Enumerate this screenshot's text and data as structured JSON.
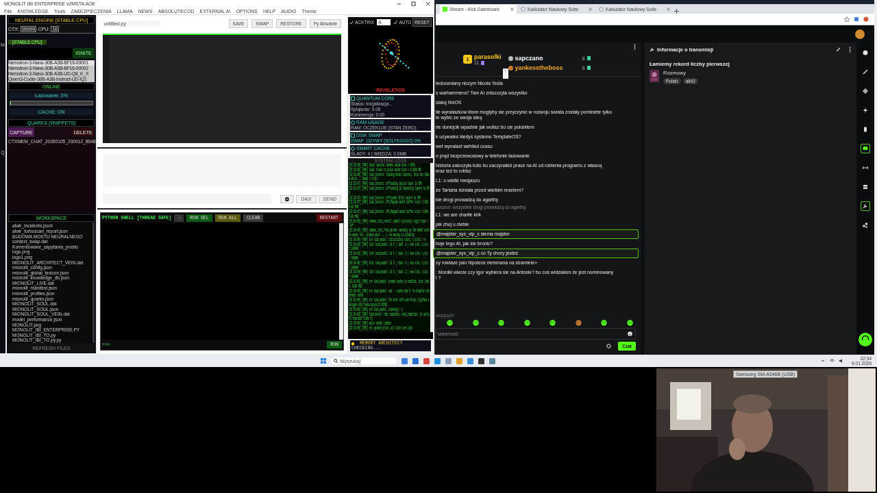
{
  "app": {
    "title": "MONOLIT IBI ENTERPRISE v2MSTA AOE",
    "side_letters": [
      "M",
      "Q"
    ],
    "menu": [
      "File",
      "KNOWLEDGE",
      "Tools",
      "ZABEZPIECZENIA",
      "LLAMA",
      "NEWS",
      "ABSOLUTECOD",
      "EXTERNAL AI",
      "OPTIONS",
      "HELP",
      "AUDIO",
      "Theme"
    ],
    "engine": {
      "title": "NEURAL ENGINE [STABLE-CPU]",
      "ctx_label": "CTX:",
      "ctx": "99999",
      "cpu_label": "CPU:",
      "cpu": "16",
      "badge": "[STABLE CPU]",
      "ignite": "IGNITE",
      "models": [
        {
          "name": "Nemotron-3-Nano-30B-A3B-BF16-00001",
          "selected": true
        },
        {
          "name": "Nemotron-3-Nano-30B-A3B-BF16-00002",
          "selected": false
        },
        {
          "name": "Nemotron-3-Nano-30B-A3B-UD-Q8_K_X",
          "selected": false
        },
        {
          "name": "Qwen3-Coder-30B-A3B-Instruct-UD-IQ1",
          "selected": false
        }
      ],
      "status": "ONLINE",
      "loading": "Ładowanie: 0%",
      "level": 0,
      "cache": "CACHE: ON"
    },
    "quarks": {
      "title": "QUARKS (SNIPPETS)",
      "capture": "CAPTURE",
      "delete": "DELETE",
      "items": [
        "CTXMEM_CHAT_20260105_230012_8648"
      ]
    },
    "workspace": {
      "title": "WORKSPACE",
      "files": [
        "alwir_incidents.jsonl",
        "alwir_turboscan_report.json",
        "BUDOWA MOSTU NEURALNEGO",
        "context_swap.dat",
        "Komentowane_zapytania_prosto",
        "logo.png",
        "logo1.png",
        "MIONOLIT_ARCHITECT_VEIN.dat",
        "mionolit_config.json",
        "mionolit_global_lexicon.json",
        "mionolit_knowledge_db.json",
        "MIONOLIT_LIVE.dat",
        "mionolit_manifest.json",
        "mionolit_profiles.json",
        "mionolit_quarks.json",
        "MIONOLIT_SOUL.dat",
        "MIONOLIT_SOUL.json",
        "MIONOLIT_SOUL_VEIN.dat",
        "model_performance.json",
        "MONOLIT.png",
        "MONOLIT_IBI_ENTERPRISE.PY",
        "MONOLIT_IBI_TO.py",
        "MONOLIT_IBI_TO.py.py"
      ],
      "refresh": "REFRESH FILES"
    },
    "editor": {
      "filename": "untitled.py",
      "buttons": [
        "SAVE",
        "SWAP",
        "RESTORE",
        "Py Absolute"
      ]
    },
    "prompt": {
      "daj": "DAJ!",
      "send": "SEND"
    },
    "shell": {
      "title": "PYTHON SHELL [THREAD SAFE]",
      "buttons": [
        {
          "label": "-",
          "kind": "dark"
        },
        {
          "label": "RUN SEL",
          "kind": "green"
        },
        {
          "label": "RUN ALL",
          "kind": "olive"
        },
        {
          "label": "CLEAR",
          "kind": "gray"
        }
      ],
      "restart": "RESTART",
      "prompt": ">>>",
      "run": "RUN"
    },
    "visual": {
      "acktrix": {
        "label": "ACKTRIX",
        "checked": true
      },
      "mode": "A",
      "auto": {
        "label": "AUTO",
        "checked": true
      },
      "reset": "RESET",
      "caption": "REVELATION"
    },
    "cards": [
      {
        "kind": "quantum",
        "title": "QUANTUM CORE",
        "lines": [
          "Status: Inicjalizacja...",
          "Splątanie: 0.00",
          "Koherencja: 0.00"
        ]
      },
      {
        "kind": "ram",
        "title": "RAM USAGE",
        "lines": [
          "RAM: OCZEKUJE (STAN ZERO)"
        ]
      },
      {
        "kind": "disk",
        "title": "DISK SWAP",
        "lines": [
          "SWAP: OŻYWY (SOLFEGGIO) 0%"
        ]
      },
      {
        "kind": "cache",
        "title": "SMART CACHE",
        "lines": [
          "ŚLADY: 4 | WIEDZA: 0.0MB"
        ]
      }
    ],
    "logs": {
      "title": "SYSTEM LOGS",
      "lines": [
        "[22:33:40] [SRV] load: special tokens cache size = 3000",
        "[22:33:40] [SRV] load: token to piece cache size = 0.9420 MB",
        "[22:33:40] [SRV] load_tensors: loading model tensors, this can take a while... (mmap = true)",
        "[22:33:47] [SRV] load_tensors: offloading output layer to GPU",
        "[22:33:47] [SRV] load_tensors: offloading 53 repeating layers to GPU",
        "[22:33:47] [SRV] load_tensors: offloaded 53/53 layers to GPU",
        "[22:33:47] [SRV] load_tensors: CPU_Mapped model buffer size = 17690.96 MiB",
        "[22:33:47] [SRV] load_tensors: CPU_Mapped model buffer size = 12040.90 MiB",
        "[22:34:00] [SRV] common_init_result: added <|im_end|> logit bias = -inf",
        "[22:34:00] [SRV] common_init_from_params: warming up the model with an empty run - please wait ... (--no-warmup to disable)",
        "[22:34:00] [SRV] srv load_model: initializing slots, n_slots = 4",
        "[22:34:00] [SRV] slot load_model: id 0 | task -1 | new slot, n_ctx = 100000",
        "[22:34:00] [SRV] slot load_model: id 1 | task -1 | new slot, n_ctx = 100000",
        "[22:34:00] [SRV] slot load_model: id 2 | task -1 | new slot, n_ctx = 100000",
        "[22:34:00] [SRV] slot load_model: id 3 | task -1 | new slot, n_ctx = 100000",
        "[22:34:00] [SRV] srv load_model: prompt cache is enabled, size limit: 8192 MiB",
        "[22:34:00] [SRV] srv load_model: use `--cache-ram 0` to disable the prompt cache",
        "[22:34:00] [SRV] srv load_model: for more info see https://github.com/ggml-org/llama.cpp/pull/16391",
        "[22:34:00] [SRV] srv load_model: thinking = 1",
        "[22:34:00] [SRV] load_model: chat template, chat_template: (# unsloth template fixes #)",
        "[22:34:00] [SRV] main: model loaded",
        "[22:34:00] [SRV] srv update_slots: all slots are idle"
      ]
    },
    "memory": {
      "title": "MEMORY ARCHITECT",
      "status": "CHECKING..."
    }
  },
  "browser": {
    "tabs": [
      {
        "title": "Stream - Kick Dashboard",
        "selected": true
      },
      {
        "title": "Kalkulator Naukowy Suite",
        "selected": false
      },
      {
        "title": "Kalkulator Naukowy Suite",
        "selected": false
      }
    ],
    "leaders": [
      {
        "rank": "1",
        "name": "parasolki",
        "count": "11",
        "color": "#f5c518"
      },
      {
        "name": "sapczano",
        "count": "8",
        "color": "#ffffff"
      },
      {
        "name": "yankesstheboss",
        "count": "6",
        "color": "#f5a623"
      }
    ],
    "messages": [
      {
        "kind": "plain",
        "lines": [
          "ledoceniany niczym Nicola Tesla"
        ]
      },
      {
        "kind": "plain",
        "lines": [
          "s warhammera? Tam AI zniszczyla wszystko"
        ]
      },
      {
        "kind": "plain",
        "lines": [
          "staluj NixOS"
        ]
      },
      {
        "kind": "plain",
        "lines": [
          "ile wynalazkow ktore moglyby sie przyczynic w rozwoju swiata zostaly pominiete tylko",
          "le wybic ze swoja ideą"
        ]
      },
      {
        "kind": "plain",
        "lines": [
          "rie donejcik wpadnie jak wolisz bo cie polubilem"
        ]
      },
      {
        "kind": "plain",
        "lines": [
          "k uzywales kiedys systemu TemplateOS?"
        ]
      },
      {
        "kind": "plain",
        "lines": [
          "wet wynalazł wehikuł czasu"
        ]
      },
      {
        "kind": "plain",
        "lines": [
          "n prąd bezprzewodowy w telefonie ladowanie"
        ]
      },
      {
        "kind": "plain",
        "lines": [
          "historia zatoczyła koło bo zaczynałeś prace na AI od robienia programu z własną",
          "eraz też to robisz"
        ]
      },
      {
        "kind": "plain",
        "lines": [
          "L1: o wielki mesjaszu"
        ]
      },
      {
        "kind": "plain",
        "lines": [
          "że Tartaria istniała przed wielkim resetem?"
        ]
      },
      {
        "kind": "plain",
        "lines": [
          "kie drogi prowadzą do agarthy"
        ]
      },
      {
        "kind": "reply",
        "lines": [
          "uuuzon: wszystkie drogi prowadzą do agarthy"
        ]
      },
      {
        "kind": "plain",
        "lines": [
          "L1: we are charlie kirk"
        ]
      },
      {
        "kind": "plain",
        "lines": [
          "jak chuj u ciebie"
        ]
      },
      {
        "kind": "mention",
        "lines": [
          "@majster_sys_vip_c siema majster"
        ]
      },
      {
        "kind": "plain",
        "lines": [
          "boje tego AI, jak sie bronic?"
        ]
      },
      {
        "kind": "mention",
        "lines": [
          "@majster_sys_vip_c co Ty chory jesteś"
        ]
      },
      {
        "kind": "plain",
        "lines": [
          "zy rowlaze pan hipoteze riemmana na stramiele>"
        ]
      },
      {
        "kind": "plain",
        "lines": [
          ": Mordki wiecie czy Igor wybiera sie na Antosie? bo coś widziałem że jest nominowany",
          "i ?"
        ]
      }
    ],
    "followers": "wujących",
    "input": {
      "placeholder": "iadomość"
    },
    "chat_button": "Czat",
    "info": {
      "title": "Informacje o transmisji",
      "stream_title": "Łamiemy rekord liczby pierwszej",
      "category": "Rozmowy",
      "tags": [
        "Polish",
        "alt42"
      ]
    },
    "rail": [
      {
        "kind": "info",
        "selected": false
      },
      {
        "kind": "pencil",
        "selected": false
      },
      {
        "kind": "target",
        "selected": false
      },
      {
        "kind": "bolt",
        "selected": false
      },
      {
        "kind": "phone",
        "selected": false
      },
      {
        "kind": "chat",
        "selected": true
      },
      {
        "kind": "arrows",
        "selected": false
      },
      {
        "kind": "server",
        "selected": false
      },
      {
        "kind": "wrench",
        "selected": true
      },
      {
        "kind": "share",
        "selected": false
      }
    ]
  },
  "taskbar": {
    "search": "Wyszukaj",
    "time": "22:34",
    "date": "9.01.2026"
  },
  "webcam": {
    "kind": "picture",
    "label": "Samsung SM-A546B (USB)"
  }
}
